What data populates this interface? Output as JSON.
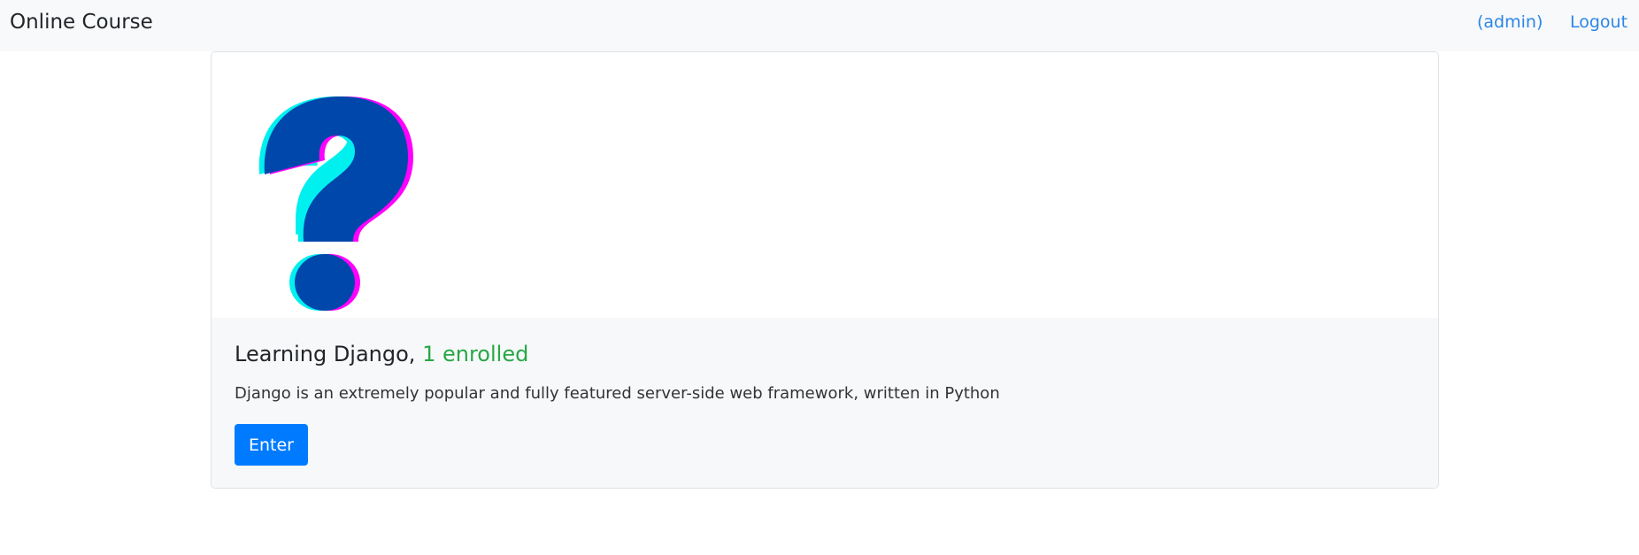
{
  "navbar": {
    "brand": "Online Course",
    "user_link": "(admin)",
    "logout_link": "Logout"
  },
  "course": {
    "image_icon": "question-mark-icon",
    "name": "Learning Django,",
    "enrolled_text": "1 enrolled",
    "description": "Django is an extremely popular and fully featured server-side web framework, written in Python",
    "enter_label": "Enter"
  },
  "colors": {
    "navbar_bg": "#f8f9fa",
    "link": "#2b86e6",
    "enrolled": "#28a745",
    "button": "#007bff",
    "question_fill": "#0047ab",
    "question_cyan": "#00f0f0",
    "question_magenta": "#ff00ff"
  }
}
